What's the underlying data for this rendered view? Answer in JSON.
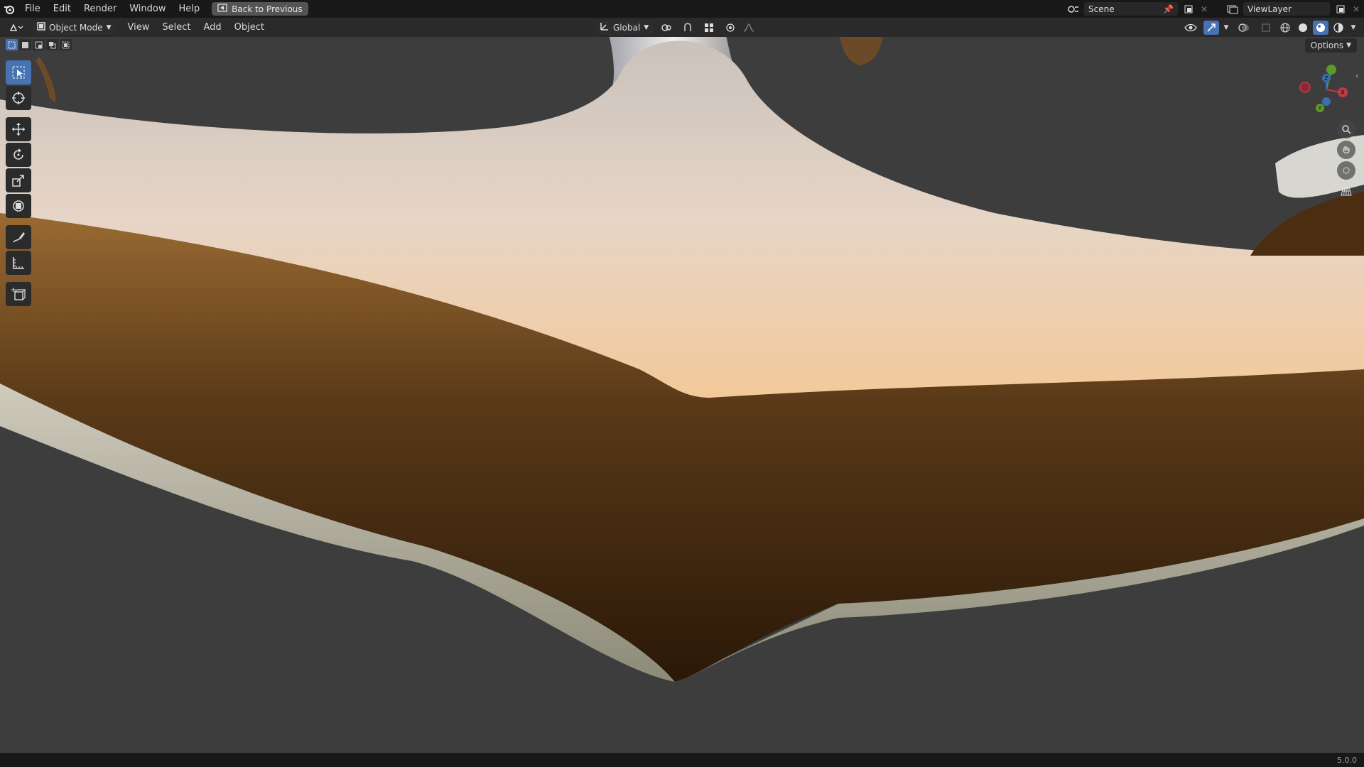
{
  "topbar": {
    "menus": [
      "File",
      "Edit",
      "Render",
      "Window",
      "Help"
    ],
    "back_button": "Back to Previous",
    "scene_name": "Scene",
    "view_layer": "ViewLayer"
  },
  "header": {
    "mode": "Object Mode",
    "menus": [
      "View",
      "Select",
      "Add",
      "Object"
    ],
    "transform_orientation": "Global"
  },
  "viewport": {
    "options_label": "Options",
    "gizmo_axes": {
      "x": "X",
      "y": "Y",
      "z": "Z"
    }
  },
  "status": {
    "version": "5.0.0"
  },
  "colors": {
    "accent": "#4772b3",
    "topbar": "#181818",
    "background": "#3d3d3d"
  }
}
